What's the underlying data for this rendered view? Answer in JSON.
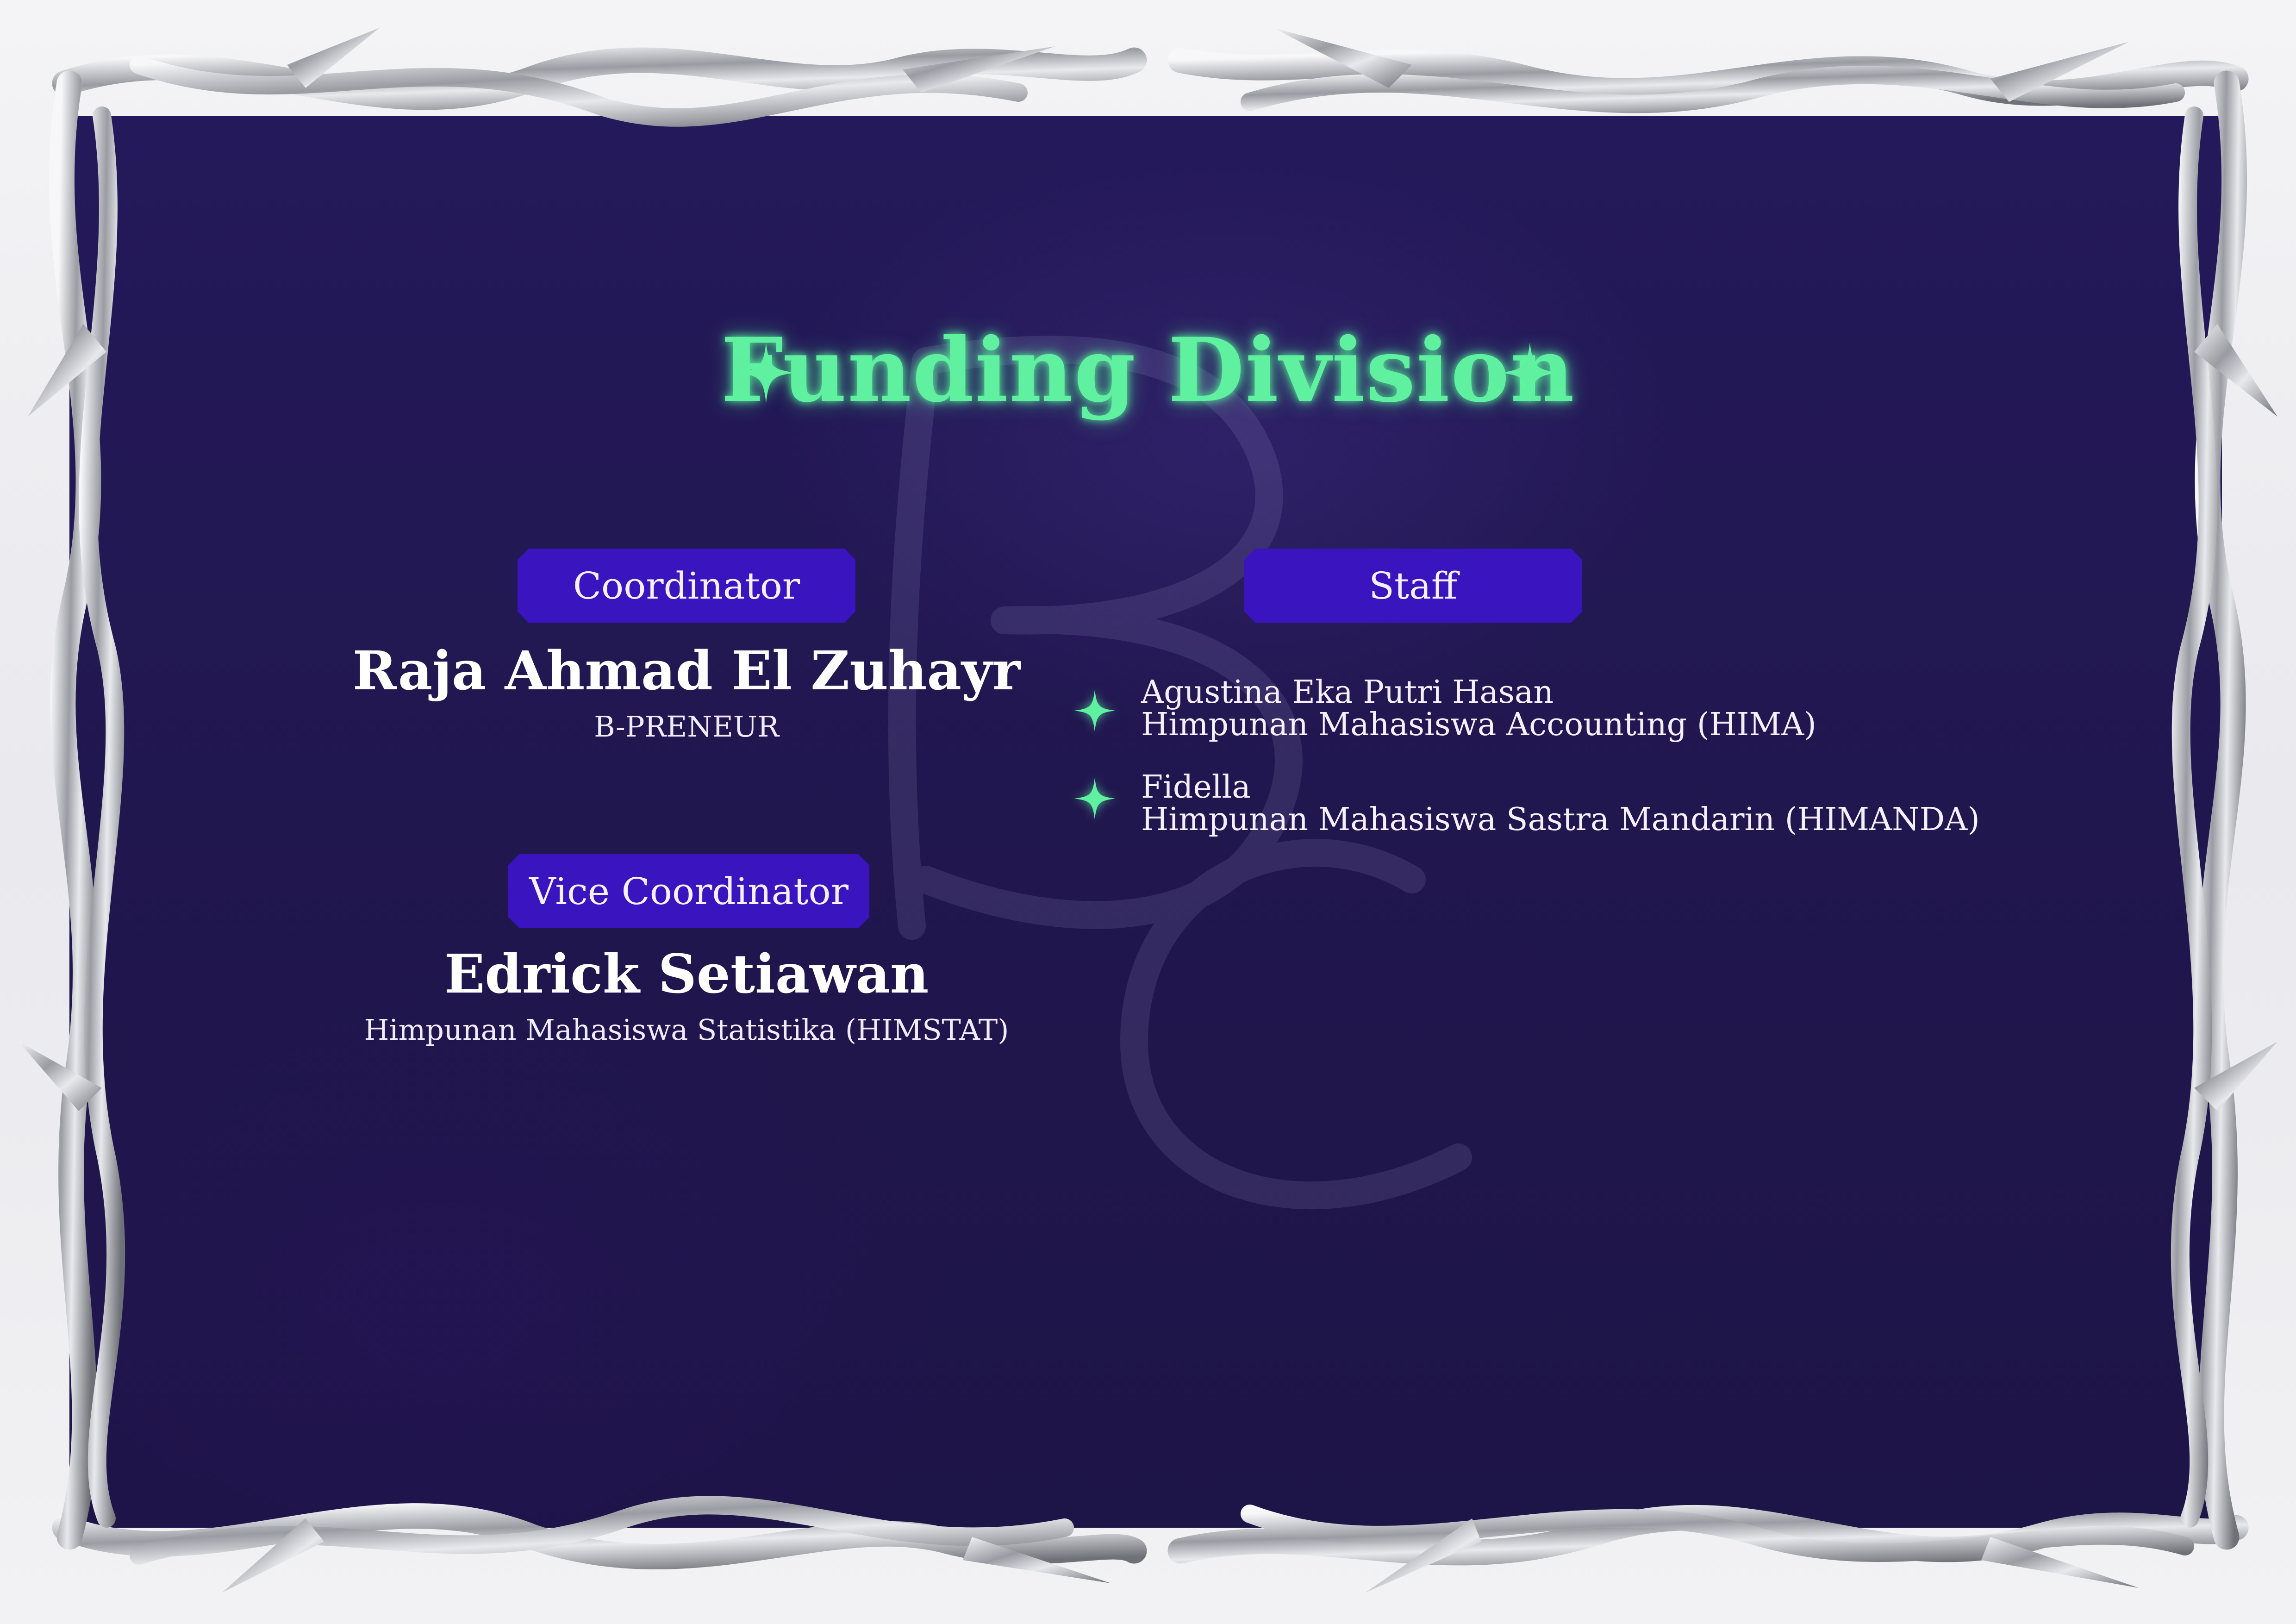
{
  "page": {
    "title": "Funding Division",
    "icons": {
      "title_star": "sparkle-icon",
      "bullet": "sparkle-icon"
    },
    "colors": {
      "background": "#21174f",
      "title": "#5ff0a0",
      "tag_fill": "#3a14bf",
      "text": "#ffffff",
      "frame": "#c9cace"
    }
  },
  "coordinator": {
    "label": "Coordinator",
    "name": "Raja Ahmad El Zuhayr",
    "org": "B-PRENEUR"
  },
  "vice_coordinator": {
    "label": "Vice Coordinator",
    "name": "Edrick Setiawan",
    "org": "Himpunan Mahasiswa Statistika (HIMSTAT)"
  },
  "staff": {
    "label": "Staff",
    "members": [
      {
        "name": "Agustina Eka Putri Hasan",
        "org": "Himpunan Mahasiswa Accounting (HIMA)"
      },
      {
        "name": "Fidella",
        "org": "Himpunan Mahasiswa Sastra Mandarin (HIMANDA)"
      }
    ]
  }
}
